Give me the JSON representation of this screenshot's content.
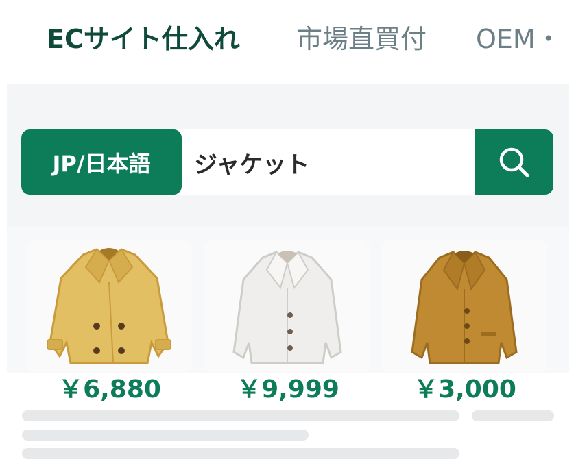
{
  "tabs": [
    {
      "label": "ECサイト仕入れ",
      "active": true
    },
    {
      "label": "市場直買付",
      "active": false
    },
    {
      "label": "OEM・",
      "active": false
    }
  ],
  "search": {
    "language_label": "JP/日本語",
    "query": "ジャケット",
    "search_icon": "search-icon"
  },
  "products": [
    {
      "name_icon": "pea-coat-icon",
      "color": "#e2bf63",
      "price": "￥6,880"
    },
    {
      "name_icon": "white-jacket-icon",
      "color": "#efeeec",
      "price": "￥9,999"
    },
    {
      "name_icon": "brown-blazer-icon",
      "color": "#bf8a32",
      "price": "￥3,000"
    }
  ],
  "colors": {
    "brand_green": "#0c7c59",
    "tab_active": "#0f4a3a",
    "tab_inactive": "#6c7f86"
  }
}
